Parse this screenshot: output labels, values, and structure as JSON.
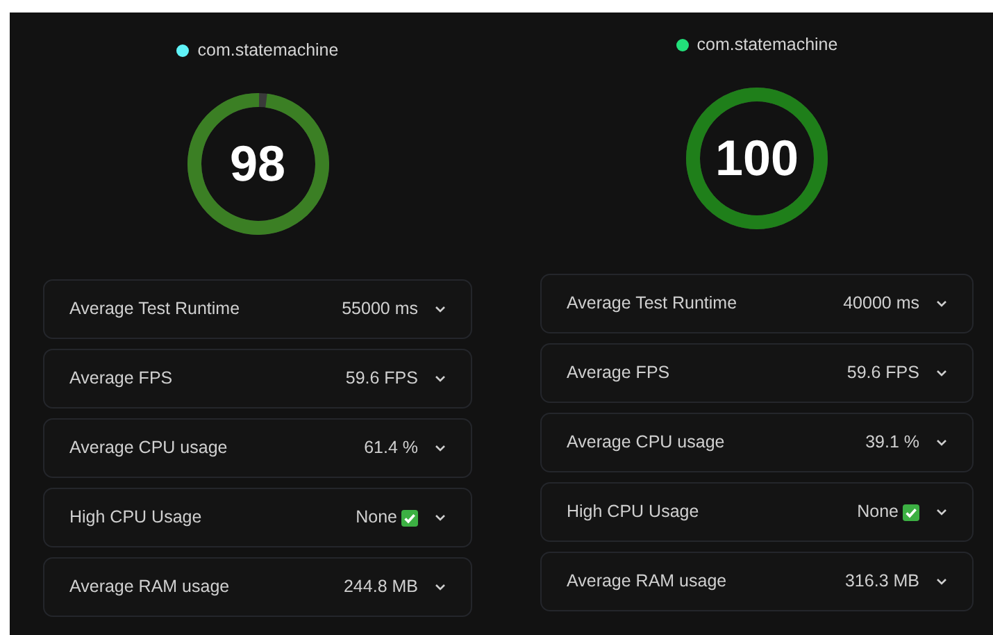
{
  "panels": [
    {
      "app": {
        "name": "com.statemachine",
        "color": "#5ff3f8"
      },
      "score": {
        "text": "98",
        "level": 0.98,
        "color": "#3b7f24"
      },
      "metrics": [
        {
          "kind": "reading",
          "label": "Average Test Runtime",
          "value": "55000 ms",
          "expanded": false
        },
        {
          "kind": "reading",
          "label": "Average FPS",
          "value": "59.6 FPS",
          "expanded": false
        },
        {
          "kind": "reading",
          "label": "Average CPU usage",
          "value": "61.4 %",
          "expanded": false
        },
        {
          "kind": "passed",
          "label": "High CPU Usage",
          "value": "None",
          "expanded": false
        },
        {
          "kind": "reading",
          "label": "Average RAM usage",
          "value": "244.8 MB",
          "expanded": false
        }
      ]
    },
    {
      "app": {
        "name": "com.statemachine",
        "color": "#22e07a"
      },
      "score": {
        "text": "100",
        "level": 1,
        "color": "#1f7f1a"
      },
      "metrics": [
        {
          "kind": "reading",
          "label": "Average Test Runtime",
          "value": "40000 ms",
          "expanded": false
        },
        {
          "kind": "reading",
          "label": "Average FPS",
          "value": "59.6 FPS",
          "expanded": false
        },
        {
          "kind": "reading",
          "label": "Average CPU usage",
          "value": "39.1 %",
          "expanded": false
        },
        {
          "kind": "passed",
          "label": "High CPU Usage",
          "value": "None",
          "expanded": false
        },
        {
          "kind": "reading",
          "label": "Average RAM usage",
          "value": "316.3 MB",
          "expanded": false
        }
      ]
    }
  ]
}
